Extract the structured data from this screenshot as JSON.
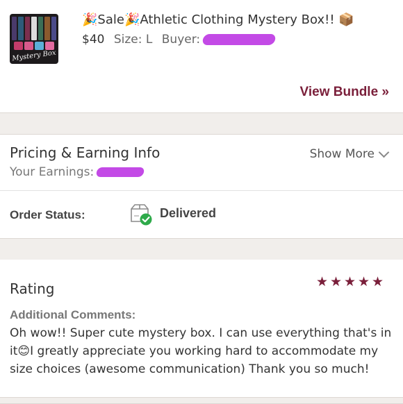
{
  "item": {
    "title_lead_emoji": "🎉",
    "title_sale": "Sale",
    "title_mid_emoji": "🎉",
    "title_text": "Athletic Clothing Mystery Box!!",
    "title_trail_emoji": "📦",
    "price": "$40",
    "size": "Size: L",
    "buyer_label": "Buyer:",
    "thumbnail_caption": "Mystery Box",
    "view_bundle": "View Bundle »"
  },
  "pricing": {
    "title": "Pricing & Earning Info",
    "earnings_label": "Your Earnings:",
    "show_more": "Show More"
  },
  "status": {
    "label": "Order Status:",
    "value": "Delivered"
  },
  "rating": {
    "title": "Rating",
    "stars": 5,
    "star_color": "#7a1f3a",
    "comments_label": "Additional Comments:",
    "comment_part1": "Oh wow!! Super cute mystery box. I can use everything that's in it",
    "comment_emoji": "😊",
    "comment_part2": "I greatly appreciate you working hard to accommodate my size choices (awesome communication) Thank you so much!"
  },
  "colors": {
    "accent": "#7a1f3a",
    "redaction": "#c34ae6",
    "band": "#f1eeeb",
    "check": "#2eaa4a"
  }
}
